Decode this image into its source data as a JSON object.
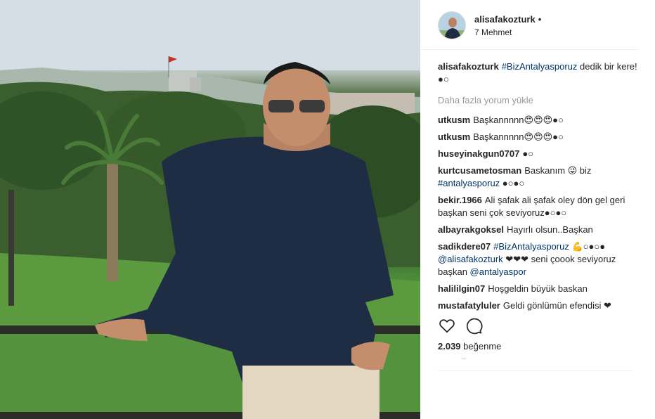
{
  "post": {
    "username": "alisafakozturk",
    "separator": "•",
    "location": "7 Mehmet",
    "caption": {
      "user": "alisafakozturk",
      "hashtag": "#BizAntalyasporuz",
      "text": "dedik bir kere! ●○"
    },
    "load_more": "Daha fazla yorum yükle",
    "comments": [
      {
        "user": "utkusm",
        "parts": [
          {
            "t": "Başkannnnn😍😍😍●○"
          }
        ]
      },
      {
        "user": "utkusm",
        "parts": [
          {
            "t": "Başkannnnn😍😍😍●○"
          }
        ]
      },
      {
        "user": "huseyinakgun0707",
        "parts": [
          {
            "t": "●○"
          }
        ]
      },
      {
        "user": "kurtcusametosman",
        "parts": [
          {
            "t": "Baskanım 😜 biz "
          },
          {
            "tag": "#antalyasporuz"
          },
          {
            "t": " ●○●○"
          }
        ]
      },
      {
        "user": "bekir.1966",
        "parts": [
          {
            "t": "Ali şafak ali şafak oley dön gel geri başkan seni çok seviyoruz●○●○"
          }
        ]
      },
      {
        "user": "albayrakgoksel",
        "parts": [
          {
            "t": "Hayırlı olsun..Başkan"
          }
        ]
      },
      {
        "user": "sadikdere07",
        "parts": [
          {
            "tag": "#BizAntalyasporuz"
          },
          {
            "t": " 💪○●○● "
          },
          {
            "tag": "@alisafakozturk"
          },
          {
            "t": " ❤❤❤ seni çoook seviyoruz başkan "
          },
          {
            "tag": "@antalyaspor"
          }
        ]
      },
      {
        "user": "halililgin07",
        "parts": [
          {
            "t": "Hoşgeldin büyük baskan"
          }
        ]
      },
      {
        "user": "mustafatyluler",
        "parts": [
          {
            "t": "Geldi gönlümün efendisi ❤"
          }
        ]
      }
    ],
    "likes_count": "2.039",
    "likes_word": "beğenme",
    "icons": {
      "like": "heart-icon",
      "comment": "comment-bubble-icon"
    },
    "colors": {
      "hashtag": "#003569",
      "muted": "#999999",
      "text": "#262626"
    }
  }
}
